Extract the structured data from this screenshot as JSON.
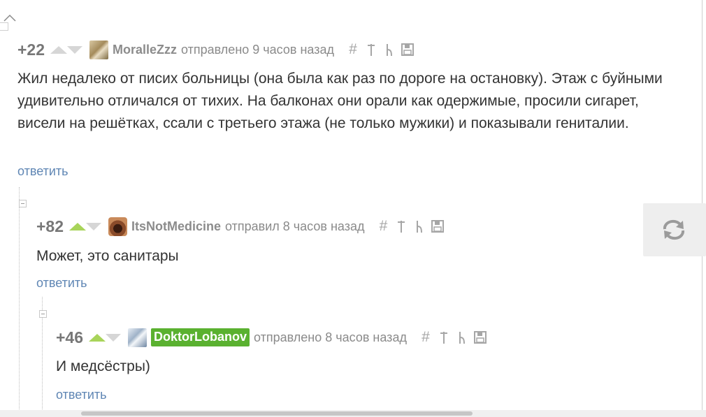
{
  "comments": [
    {
      "rating": "+22",
      "username": "MoralleZzz",
      "meta": "отправлено 9 часов назад",
      "text": "Жил недалеко от писих больницы (она была как раз по дороге на остановку). Этаж с буйными удивительно отличался от тихих. На балконах они орали как одержимые, просили сигарет, висели на решётках, ссали с третьего этажа (не только мужики) и показывали гениталии.",
      "reply": "ответить",
      "upvoted": false
    },
    {
      "rating": "+82",
      "username": "ItsNotMedicine",
      "meta": "отправил 8 часов назад",
      "text": "Может, это санитары",
      "reply": "ответить",
      "upvoted": true
    },
    {
      "rating": "+46",
      "username": "DoktorLobanov",
      "meta": "отправлено 8 часов назад",
      "text": "И медсёстры)",
      "reply": "ответить",
      "upvoted": true
    }
  ],
  "icons": [
    "hash-icon",
    "pin-up-icon",
    "branch-icon",
    "save-icon",
    "refresh-icon",
    "chevron-up-icon"
  ],
  "colors": {
    "link": "#5f86b4",
    "upvote_active": "#a8d45a",
    "badge": "#5ab130"
  }
}
